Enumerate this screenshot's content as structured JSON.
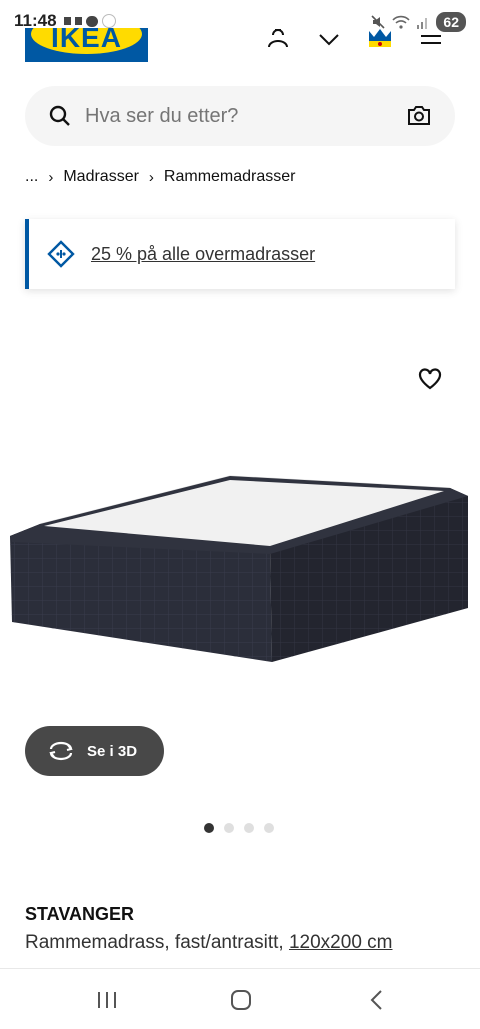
{
  "status_bar": {
    "time": "11:48",
    "battery": "62"
  },
  "header": {
    "logo_text": "IKEA",
    "icons": [
      "user-icon",
      "chevron-icon",
      "family-icon",
      "menu-icon"
    ]
  },
  "search": {
    "placeholder": "Hva ser du etter?"
  },
  "breadcrumb": {
    "ellipsis": "...",
    "items": [
      "Madrasser",
      "Rammemadrasser"
    ]
  },
  "promo": {
    "text": "25 % på alle overmadrasser"
  },
  "product": {
    "view_3d_label": "Se i 3D",
    "image_count": 4,
    "active_image": 1,
    "name": "STAVANGER",
    "description": "Rammemadrass, fast/antrasitt,",
    "size": "120x200 cm"
  },
  "colors": {
    "ikea_blue": "#0058a3",
    "ikea_yellow": "#ffdb00",
    "button_dark": "#484848"
  }
}
